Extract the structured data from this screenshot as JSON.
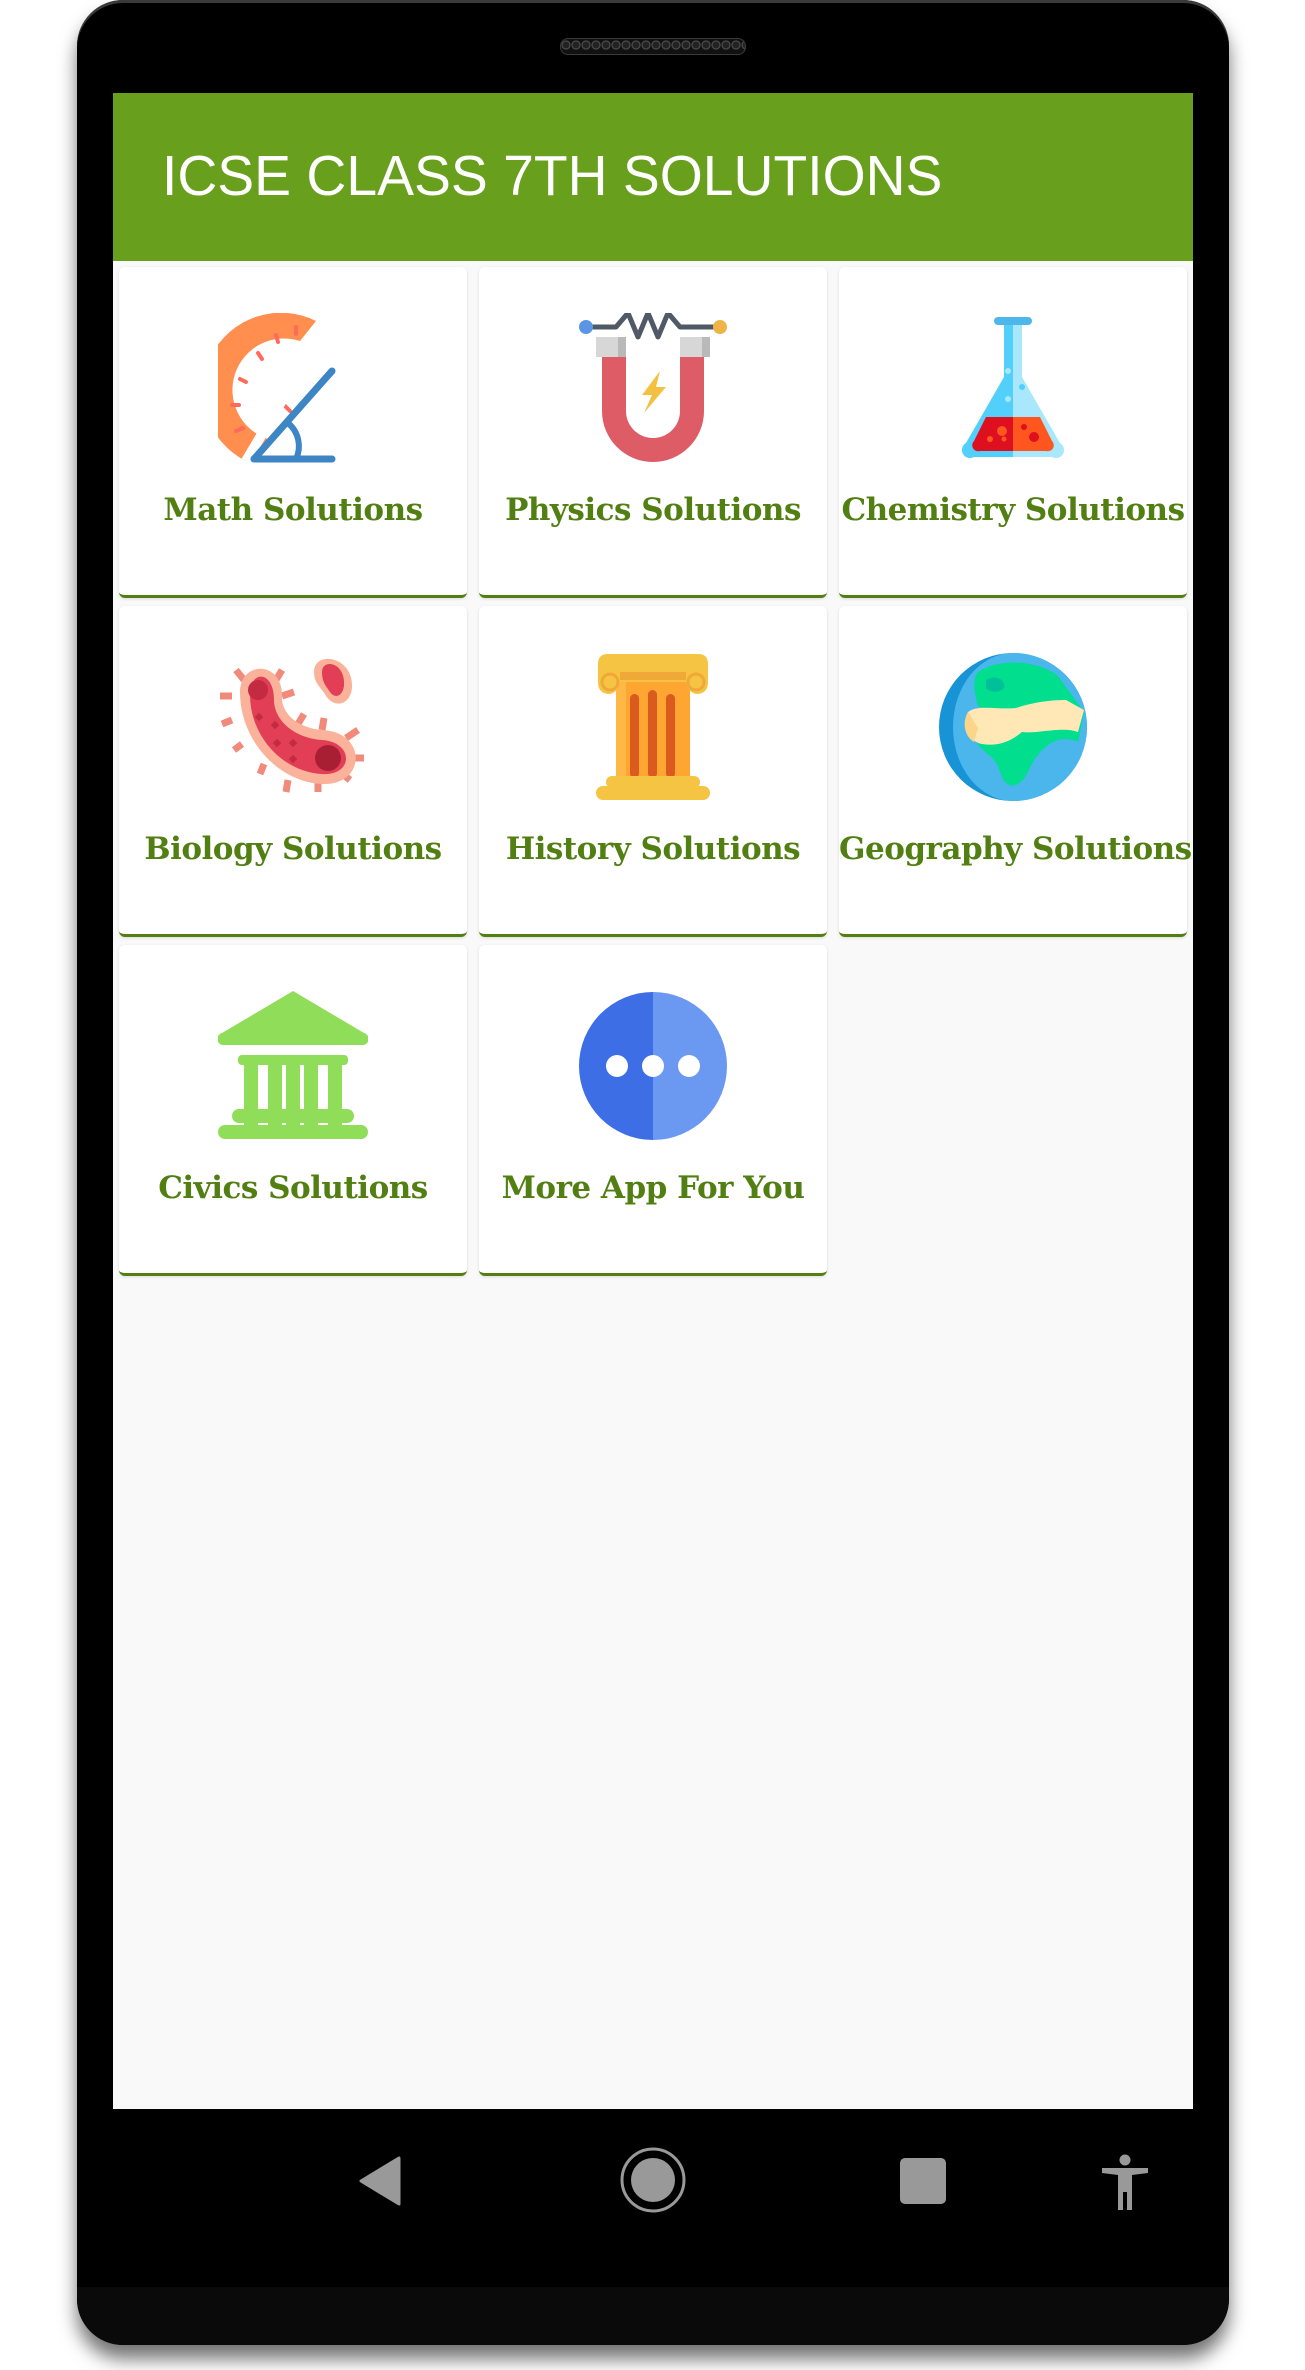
{
  "app": {
    "title": "ICSE CLASS 7TH SOLUTIONS",
    "theme": {
      "primary": "#689F1C",
      "label_color": "#527F12",
      "background": "#F9F9F9"
    }
  },
  "grid": {
    "items": [
      {
        "label": "Math Solutions",
        "icon": "protractor-icon"
      },
      {
        "label": "Physics Solutions",
        "icon": "magnet-icon"
      },
      {
        "label": "Chemistry Solutions",
        "icon": "flask-icon"
      },
      {
        "label": "Biology Solutions",
        "icon": "bacteria-icon"
      },
      {
        "label": "History Solutions",
        "icon": "pillar-icon"
      },
      {
        "label": "Geography Solutions",
        "icon": "globe-icon"
      },
      {
        "label": "Civics Solutions",
        "icon": "government-building-icon"
      },
      {
        "label": "More App For You",
        "icon": "more-dots-icon"
      }
    ]
  },
  "system_nav": {
    "buttons": [
      "back",
      "home",
      "recents",
      "accessibility"
    ]
  }
}
